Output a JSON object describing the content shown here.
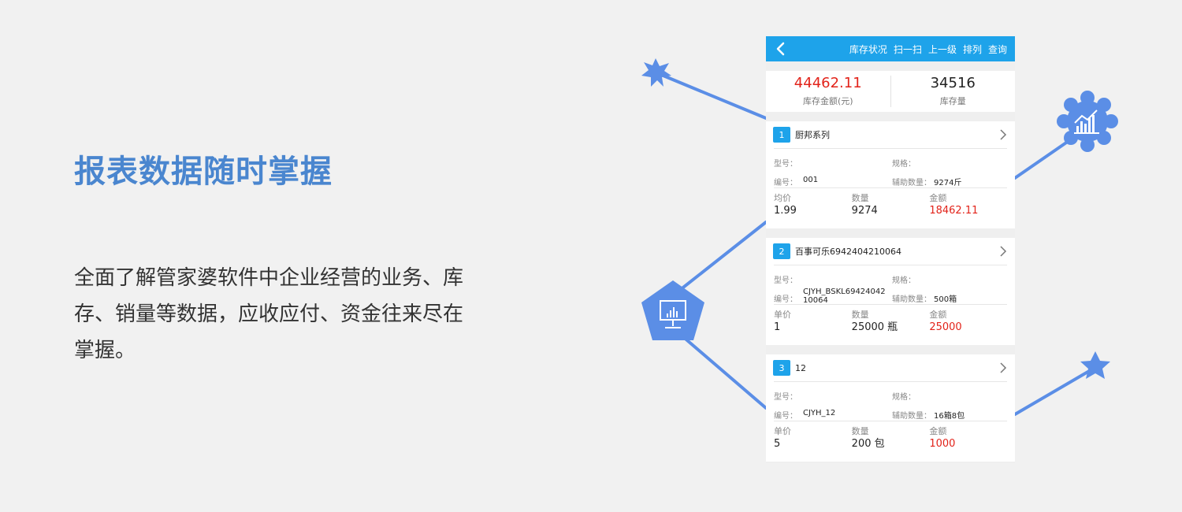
{
  "headline": "报表数据随时掌握",
  "description": "全面了解管家婆软件中企业经营的业务、库存、销量等数据，应收应付、资金往来尽在掌握。",
  "colors": {
    "accent_blue": "#1ea3ea",
    "title_blue": "#4a86cf",
    "amount_red": "#e2231a",
    "decor_blue": "#5b8ee6"
  },
  "icons": [
    "starburst-icon",
    "cloud-chart-icon",
    "monitor-chart-icon",
    "star-icon",
    "back-arrow-icon",
    "chevron-right-icon"
  ],
  "navbar": {
    "items": [
      "库存状况",
      "扫一扫",
      "上一级",
      "排列",
      "查询"
    ]
  },
  "summary": {
    "amount_value": "44462.11",
    "amount_label": "库存金额(元)",
    "qty_value": "34516",
    "qty_label": "库存量"
  },
  "cards": [
    {
      "index": "1",
      "title": "厨邦系列",
      "model_label": "型号：",
      "spec_label": "规格：",
      "code_label": "编号：",
      "code_value": "001",
      "aux_label": "辅助数量：",
      "aux_value": "9274斤",
      "price_label": "均价",
      "price_value": "1.99",
      "qty_label": "数量",
      "qty_value": "9274",
      "amount_label": "金额",
      "amount_value": "18462.11"
    },
    {
      "index": "2",
      "title": "百事可乐6942404210064",
      "model_label": "型号：",
      "spec_label": "规格：",
      "code_label": "编号：",
      "code_value_line1": "CJYH_BSKL69424042",
      "code_value_line2": "10064",
      "aux_label": "辅助数量：",
      "aux_value": "500箱",
      "price_label": "单价",
      "price_value": "1",
      "qty_label": "数量",
      "qty_value": "25000 瓶",
      "amount_label": "金额",
      "amount_value": "25000"
    },
    {
      "index": "3",
      "title": "12",
      "model_label": "型号：",
      "spec_label": "规格：",
      "code_label": "编号：",
      "code_value": "CJYH_12",
      "aux_label": "辅助数量：",
      "aux_value": "16箱8包",
      "price_label": "单价",
      "price_value": "5",
      "qty_label": "数量",
      "qty_value": "200 包",
      "amount_label": "金额",
      "amount_value": "1000"
    }
  ]
}
